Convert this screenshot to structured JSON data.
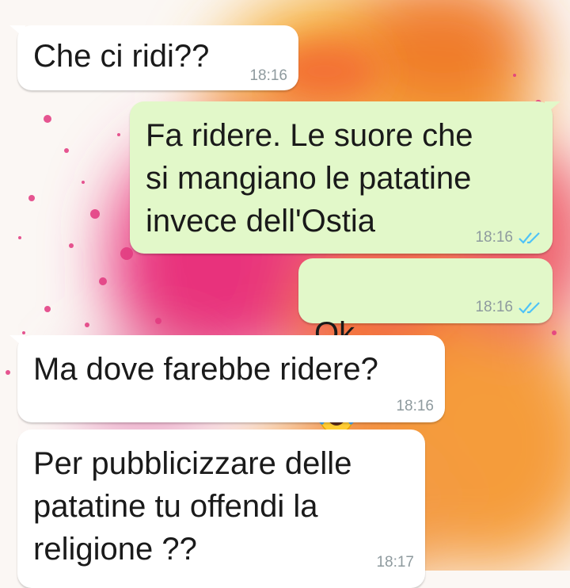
{
  "theme": {
    "incoming_bubble": "#ffffff",
    "outgoing_bubble": "#e2f8c9",
    "timestamp_color": "#8e9a9e",
    "read_tick_color": "#4fc3f7"
  },
  "messages": [
    {
      "direction": "in",
      "text": "Che ci ridi??",
      "time": "18:16"
    },
    {
      "direction": "out",
      "text": "Fa ridere. Le suore che\nsi mangiano le patatine\ninvece dell'Ostia",
      "time": "18:16",
      "status_icon": "double-check-icon"
    },
    {
      "direction": "out",
      "text": "Ok",
      "emoji": [
        "face-with-tears-of-joy-icon",
        "face-with-tears-of-joy-icon"
      ],
      "time": "18:16",
      "status_icon": "double-check-icon"
    },
    {
      "direction": "in",
      "text": "Ma dove farebbe ridere?",
      "time": "18:16"
    },
    {
      "direction": "in",
      "text": "Per pubblicizzare delle\npatatine tu offendi la\nreligione ??",
      "time": "18:17"
    }
  ]
}
